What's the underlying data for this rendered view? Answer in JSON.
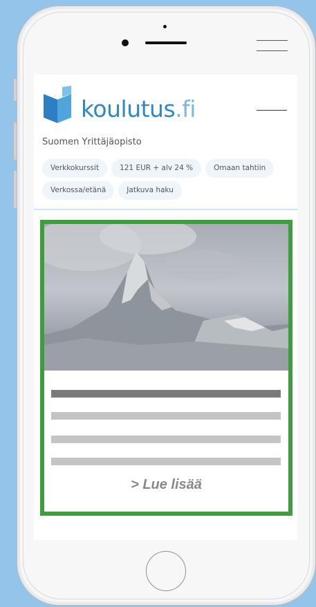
{
  "brand": {
    "name_main": "koulutus",
    "name_suffix": ".fi",
    "logo_icon": "book-flag-icon",
    "color": "#1f74b8"
  },
  "course": {
    "provider": "Suomen Yrittäjäopisto",
    "tags": [
      "Verkkokurssit",
      "121 EUR + alv 24 %",
      "Omaan tahtiin",
      "Verkossa/etänä",
      "Jatkuva haku"
    ]
  },
  "card": {
    "image_icon": "mountain-landscape-image",
    "read_more": "> Lue lisää",
    "border_color": "#3d9d3f"
  },
  "device": {
    "menu_icon": "hamburger-menu-icon",
    "home_icon": "home-button-icon"
  }
}
